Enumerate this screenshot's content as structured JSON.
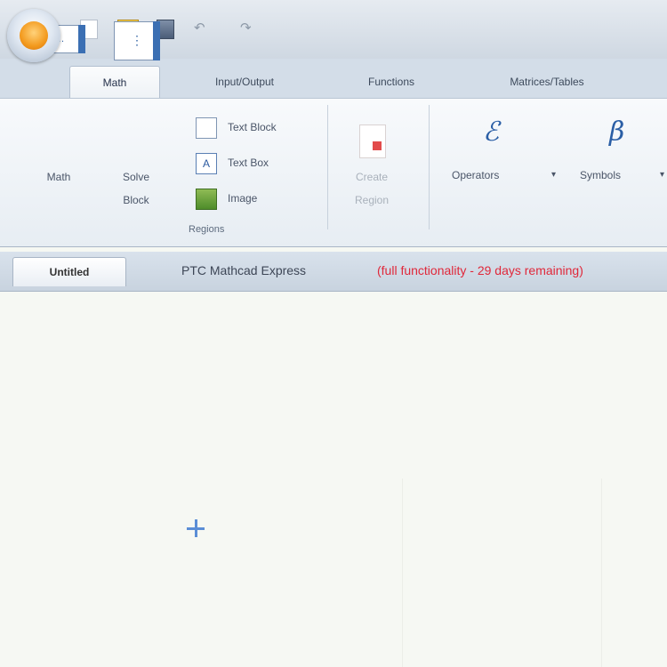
{
  "quick_access": {
    "icons": [
      "app-menu-icon",
      "new-document-icon",
      "open-folder-icon",
      "save-icon",
      "undo-icon",
      "redo-icon"
    ]
  },
  "tabs": [
    {
      "label": "Math",
      "active": true
    },
    {
      "label": "Input/Output",
      "active": false
    },
    {
      "label": "Functions",
      "active": false
    },
    {
      "label": "Matrices/Tables",
      "active": false
    },
    {
      "label": "",
      "active": false
    }
  ],
  "ribbon": {
    "math_label": "Math",
    "solve_label": "Solve",
    "solve_label2": "Block",
    "text_block": "Text Block",
    "text_box": "Text Box",
    "image": "Image",
    "regions_group": "Regions",
    "create_label": "Create",
    "create_label2": "Region",
    "operators": "Operators",
    "symbols": "Symbols",
    "dropdown_glyph": "▾"
  },
  "document": {
    "tab": "Untitled",
    "app_name": "PTC Mathcad Express",
    "trial_notice": "(full functionality - 29 days remaining)"
  },
  "colors": {
    "accent": "#3b6fb3",
    "trial_text": "#e0283a",
    "worksheet_bg": "#f6f8f3"
  }
}
